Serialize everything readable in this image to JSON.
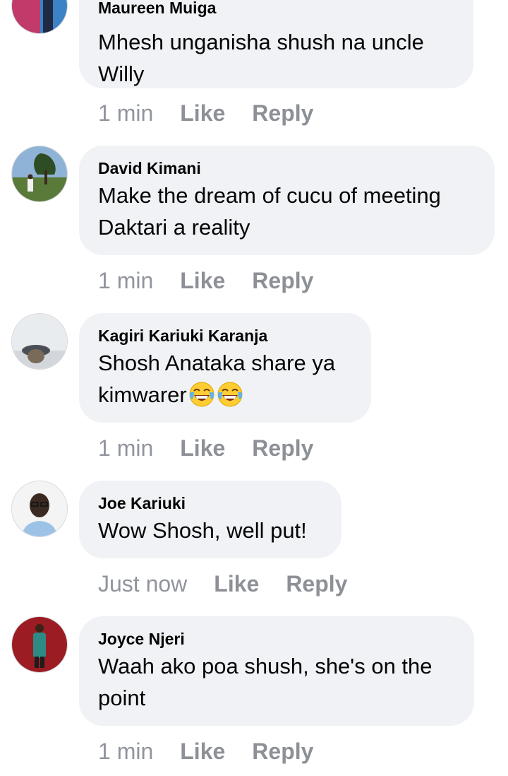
{
  "comments": [
    {
      "author": "Maureen Muiga",
      "text_lines": [
        "Mhesh unganisha shush na uncle",
        "Willy"
      ],
      "time": "1 min",
      "like": "Like",
      "reply": "Reply"
    },
    {
      "author": "David Kimani",
      "text_lines": [
        "Make the dream of cucu of meeting",
        "Daktari a reality"
      ],
      "time": "1 min",
      "like": "Like",
      "reply": "Reply"
    },
    {
      "author": "Kagiri Kariuki Karanja",
      "text_lines": [
        "Shosh Anataka share ya",
        "kimwarer"
      ],
      "emoji": [
        "face-with-tears-of-joy",
        "face-with-tears-of-joy"
      ],
      "time": "1 min",
      "like": "Like",
      "reply": "Reply"
    },
    {
      "author": "Joe Kariuki",
      "text_lines": [
        "Wow Shosh, well put!"
      ],
      "time": "Just now",
      "like": "Like",
      "reply": "Reply"
    },
    {
      "author": "Joyce Njeri",
      "text_lines": [
        "Waah ako poa shush, she's on the",
        "point"
      ],
      "time": "1 min",
      "like": "Like",
      "reply": "Reply"
    }
  ],
  "colors": {
    "bubble": "#f0f2f5",
    "text": "#050505",
    "meta": "#90949c"
  }
}
